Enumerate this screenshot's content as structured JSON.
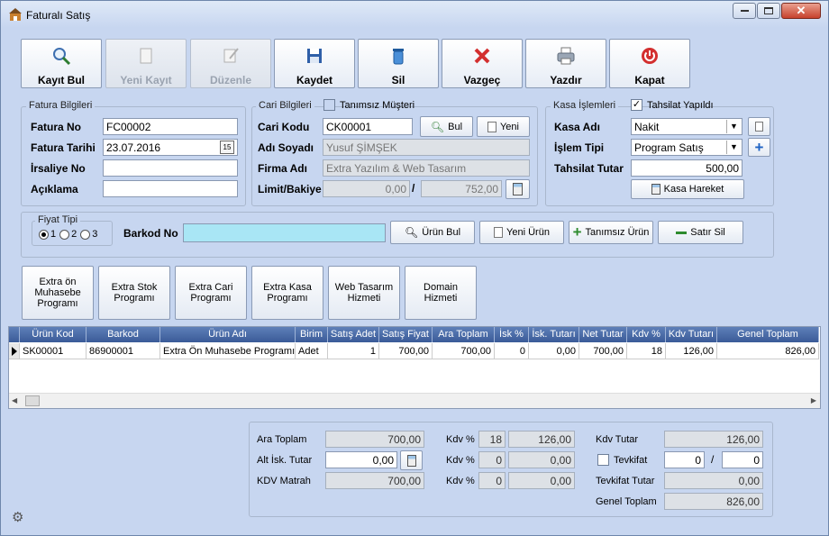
{
  "window": {
    "title": "Faturalı Satış"
  },
  "toolbar": [
    {
      "label": "Kayıt Bul",
      "icon": "magnifier-icon",
      "enabled": true
    },
    {
      "label": "Yeni Kayıt",
      "icon": "new-document-icon",
      "enabled": false
    },
    {
      "label": "Düzenle",
      "icon": "edit-icon",
      "enabled": false
    },
    {
      "label": "Kaydet",
      "icon": "floppy-disk-icon",
      "enabled": true
    },
    {
      "label": "Sil",
      "icon": "trash-icon",
      "enabled": true
    },
    {
      "label": "Vazgeç",
      "icon": "red-x-icon",
      "enabled": true
    },
    {
      "label": "Yazdır",
      "icon": "printer-icon",
      "enabled": true
    },
    {
      "label": "Kapat",
      "icon": "power-icon",
      "enabled": true
    }
  ],
  "fatura": {
    "group_label": "Fatura Bilgileri",
    "no_label": "Fatura No",
    "no": "FC00002",
    "tarih_label": "Fatura Tarihi",
    "tarih": "23.07.2016",
    "irsaliye_label": "İrsaliye No",
    "irsaliye": "",
    "aciklama_label": "Açıklama",
    "aciklama": ""
  },
  "cari": {
    "group_label": "Cari Bilgileri",
    "tanimsiz_label": "Tanımsız Müşteri",
    "tanimsiz_checked": false,
    "kodu_label": "Cari Kodu",
    "kodu": "CK00001",
    "bul_label": "Bul",
    "yeni_label": "Yeni",
    "adsoyad_label": "Adı Soyadı",
    "adsoyad": "Yusuf ŞİMŞEK",
    "firma_label": "Firma Adı",
    "firma": "Extra Yazılım & Web Tasarım",
    "limit_label": "Limit/Bakiye",
    "limit": "0,00",
    "sep": "/",
    "bakiye": "752,00"
  },
  "kasa": {
    "group_label": "Kasa İşlemleri",
    "tahsilat_label": "Tahsilat Yapıldı",
    "tahsilat_checked": true,
    "adi_label": "Kasa Adı",
    "adi": "Nakit",
    "islem_label": "İşlem Tipi",
    "islem": "Program Satış",
    "tutar_label": "Tahsilat Tutar",
    "tutar": "500,00",
    "hareket_label": "Kasa Hareket"
  },
  "fiyat": {
    "group_label": "Fiyat Tipi",
    "options": [
      "1",
      "2",
      "3"
    ],
    "selected": "1"
  },
  "barkod": {
    "label": "Barkod No",
    "value": ""
  },
  "item_buttons": {
    "urun_bul": "Ürün Bul",
    "yeni_urun": "Yeni Ürün",
    "tanimsiz_urun": "Tanımsız Ürün",
    "satir_sil": "Satır Sil"
  },
  "shortcuts": [
    "Extra ön Muhasebe Programı",
    "Extra Stok Programı",
    "Extra Cari Programı",
    "Extra Kasa Programı",
    "Web Tasarım Hizmeti",
    "Domain Hizmeti"
  ],
  "grid": {
    "columns": [
      "Ürün Kod",
      "Barkod",
      "Ürün Adı",
      "Birim",
      "Satış Adet",
      "Satış Fiyat",
      "Ara Toplam",
      "İsk %",
      "İsk. Tutarı",
      "Net Tutar",
      "Kdv %",
      "Kdv Tutarı",
      "Genel Toplam"
    ],
    "rows": [
      [
        "SK00001",
        "86900001",
        "Extra Ön Muhasebe Programı",
        "Adet",
        "1",
        "700,00",
        "700,00",
        "0",
        "0,00",
        "700,00",
        "18",
        "126,00",
        "826,00"
      ]
    ]
  },
  "totals": {
    "ara_label": "Ara Toplam",
    "ara": "700,00",
    "alt_isk_label": "Alt İsk. Tutar",
    "alt_isk": "0,00",
    "matrah_label": "KDV Matrah",
    "matrah": "700,00",
    "kdv_label": "Kdv %",
    "kdv1_rate": "18",
    "kdv1_amt": "126,00",
    "kdv2_rate": "0",
    "kdv2_amt": "0,00",
    "kdv3_rate": "0",
    "kdv3_amt": "0,00",
    "kdv_tutar_label": "Kdv Tutar",
    "kdv_tutar": "126,00",
    "tevkifat_label": "Tevkifat",
    "tevkifat_a": "0",
    "tevkifat_sep": "/",
    "tevkifat_b": "0",
    "tevkifat_tutar_label": "Tevkifat Tutar",
    "tevkifat_tutar": "0,00",
    "genel_label": "Genel Toplam",
    "genel": "826,00"
  },
  "colors": {
    "window_bg": "#c7d6f0",
    "grid_header": "#3a5b98",
    "barkod_bg": "#a9e6f5"
  }
}
